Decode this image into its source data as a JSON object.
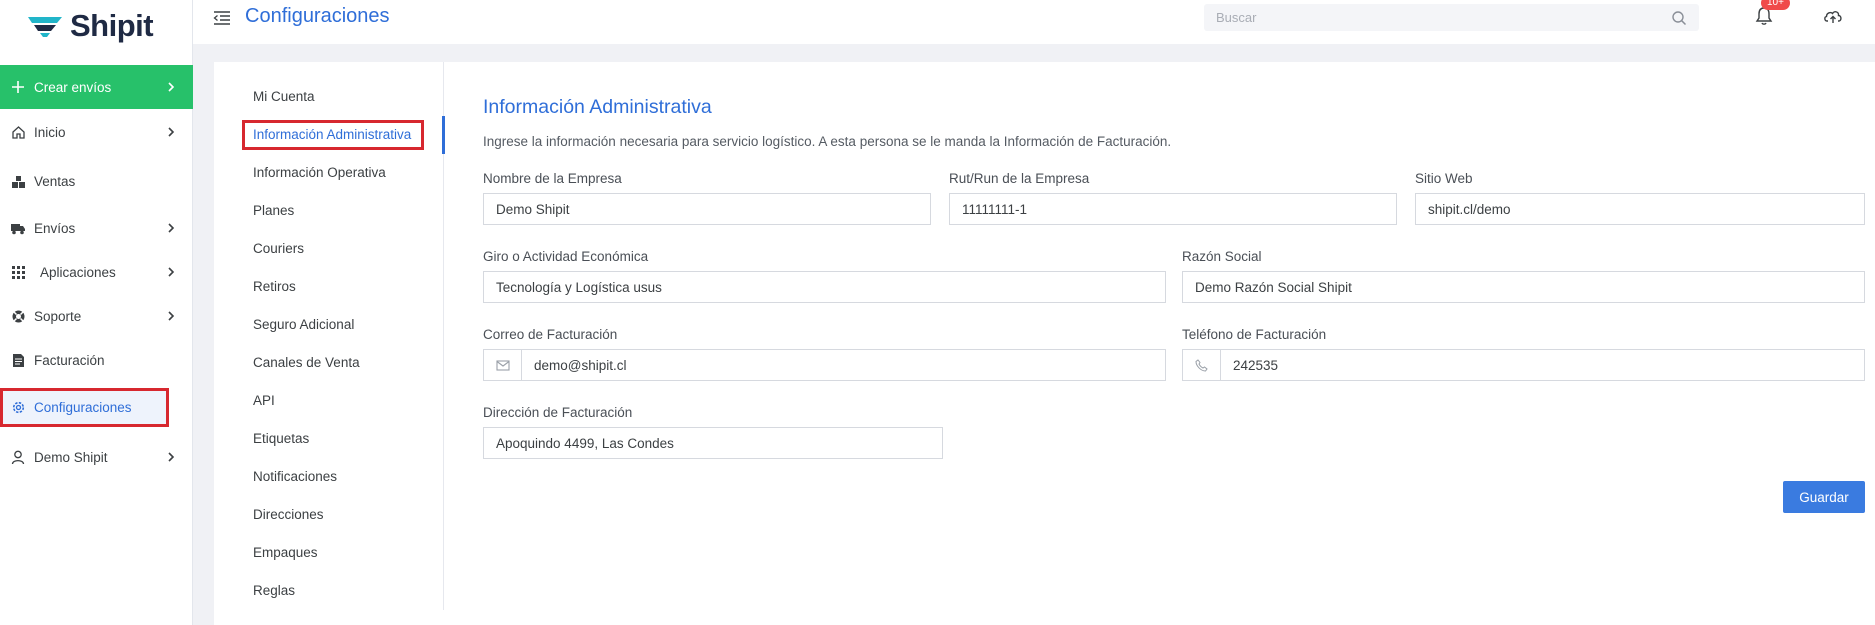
{
  "app": {
    "logo_text": "Shipit",
    "brand_color": "#2f6ed8",
    "accent_green": "#27c16a"
  },
  "header": {
    "title": "Configuraciones",
    "search_placeholder": "Buscar",
    "notification_badge": "10+"
  },
  "sidebar": {
    "items": [
      {
        "label": "Crear envíos",
        "icon": "plus-icon",
        "chevron": true
      },
      {
        "label": "Inicio",
        "icon": "home-icon",
        "chevron": true
      },
      {
        "label": "Ventas",
        "icon": "boxes-icon",
        "chevron": false
      },
      {
        "label": "Envíos",
        "icon": "truck-icon",
        "chevron": true
      },
      {
        "label": "Aplicaciones",
        "icon": "grid-icon",
        "chevron": true
      },
      {
        "label": "Soporte",
        "icon": "lifebuoy-icon",
        "chevron": true
      },
      {
        "label": "Facturación",
        "icon": "invoice-icon",
        "chevron": false
      },
      {
        "label": "Configuraciones",
        "icon": "gear-icon",
        "chevron": false,
        "active": true
      },
      {
        "label": "Demo Shipit",
        "icon": "user-icon",
        "chevron": true
      }
    ]
  },
  "settings_nav": {
    "items": [
      "Mi Cuenta",
      "Información Administrativa",
      "Información Operativa",
      "Planes",
      "Couriers",
      "Retiros",
      "Seguro Adicional",
      "Canales de Venta",
      "API",
      "Etiquetas",
      "Notificaciones",
      "Direcciones",
      "Empaques",
      "Reglas"
    ],
    "active": "Información Administrativa"
  },
  "form": {
    "title": "Información Administrativa",
    "description": "Ingrese la información necesaria para servicio logístico. A esta persona se le manda la Información de Facturación.",
    "fields": {
      "company_name": {
        "label": "Nombre de la Empresa",
        "value": "Demo Shipit"
      },
      "rut": {
        "label": "Rut/Run de la Empresa",
        "value": "11111111-1"
      },
      "website": {
        "label": "Sitio Web",
        "value": "shipit.cl/demo"
      },
      "activity": {
        "label": "Giro o Actividad Económica",
        "value": "Tecnología y Logística usus"
      },
      "business_name": {
        "label": "Razón Social",
        "value": "Demo Razón Social Shipit"
      },
      "billing_email": {
        "label": "Correo de Facturación",
        "value": "demo@shipit.cl"
      },
      "billing_phone": {
        "label": "Teléfono de Facturación",
        "value": "242535"
      },
      "billing_address": {
        "label": "Dirección de Facturación",
        "value": "Apoquindo 4499, Las Condes"
      }
    },
    "save_label": "Guardar"
  }
}
